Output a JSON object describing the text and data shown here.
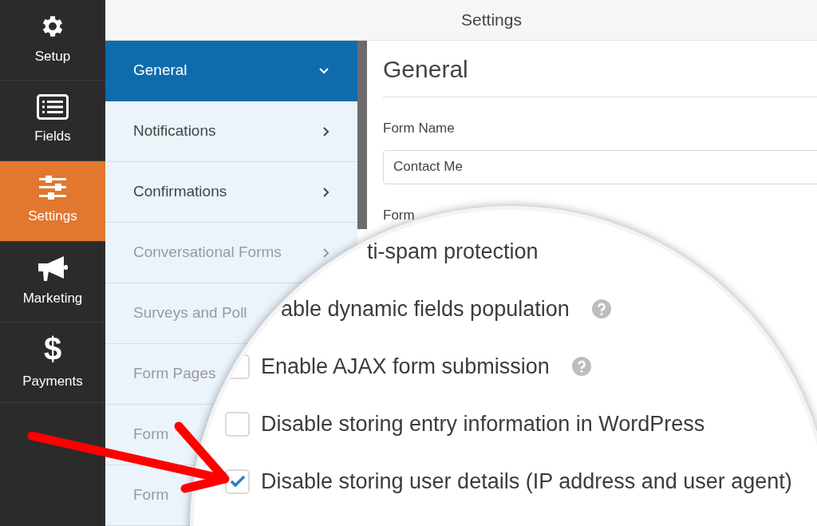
{
  "sidebar": {
    "items": [
      {
        "label": "Setup",
        "selected": false
      },
      {
        "label": "Fields",
        "selected": false
      },
      {
        "label": "Settings",
        "selected": true
      },
      {
        "label": "Marketing",
        "selected": false
      },
      {
        "label": "Payments",
        "selected": false,
        "glyph": "$"
      }
    ]
  },
  "header": {
    "title": "Settings"
  },
  "menu": {
    "items": [
      {
        "label": "General",
        "selected": true,
        "expanded": true,
        "disabled": false
      },
      {
        "label": "Notifications",
        "selected": false,
        "expanded": false,
        "disabled": false
      },
      {
        "label": "Confirmations",
        "selected": false,
        "expanded": false,
        "disabled": false
      },
      {
        "label": "Conversational Forms",
        "selected": false,
        "expanded": false,
        "disabled": true
      },
      {
        "label": "Surveys and Poll",
        "selected": false,
        "disabled": true
      },
      {
        "label": "Form Pages",
        "selected": false,
        "disabled": true
      },
      {
        "label": "Form",
        "selected": false,
        "disabled": true
      },
      {
        "label": "Form",
        "selected": false,
        "disabled": true
      }
    ]
  },
  "panel": {
    "title": "General",
    "fields": [
      {
        "label": "Form Name",
        "value": "Contact Me"
      }
    ],
    "next_label": "Form"
  },
  "magnifier": {
    "options": [
      {
        "label": "ti-spam protection",
        "help": false
      },
      {
        "label": "able dynamic fields population",
        "help": true
      },
      {
        "label": "Enable AJAX form submission",
        "help": true,
        "checked": false
      },
      {
        "label": "Disable storing entry information in WordPress",
        "help": false,
        "checked": false
      },
      {
        "label": "Disable storing user details (IP address and user agent)",
        "help": false,
        "checked": true
      }
    ]
  }
}
